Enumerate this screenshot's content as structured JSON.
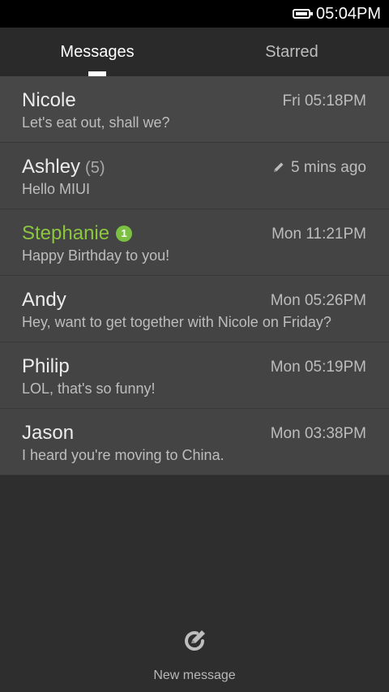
{
  "status_bar": {
    "time": "05:04PM",
    "battery_icon": "battery-icon"
  },
  "tabs": [
    {
      "label": "Messages",
      "selected": true
    },
    {
      "label": "Starred",
      "selected": false
    }
  ],
  "conversations": [
    {
      "name": "Nicole",
      "count": "",
      "time": "Fri 05:18PM",
      "snippet": "Let's eat out, shall we?",
      "unread": false,
      "draft": false
    },
    {
      "name": "Ashley",
      "count": "(5)",
      "time": "5 mins ago",
      "snippet": "Hello MIUI",
      "unread": false,
      "draft": true
    },
    {
      "name": "Stephanie",
      "count": "",
      "badge": "1",
      "time": "Mon 11:21PM",
      "snippet": "Happy Birthday to you!",
      "unread": true,
      "draft": false
    },
    {
      "name": "Andy",
      "count": "",
      "time": "Mon 05:26PM",
      "snippet": "Hey, want to get together with Nicole on Friday?",
      "unread": false,
      "draft": false
    },
    {
      "name": "Philip",
      "count": "",
      "time": "Mon 05:19PM",
      "snippet": "LOL, that's so funny!",
      "unread": false,
      "draft": false
    },
    {
      "name": "Jason",
      "count": "",
      "time": "Mon 03:38PM",
      "snippet": "I heard you're moving to China.",
      "unread": false,
      "draft": false
    }
  ],
  "bottom_action": {
    "label": "New message",
    "icon": "compose-icon"
  },
  "colors": {
    "unread_accent": "#8cc63f",
    "background": "#2e2e2e",
    "row_background": "#444444"
  }
}
